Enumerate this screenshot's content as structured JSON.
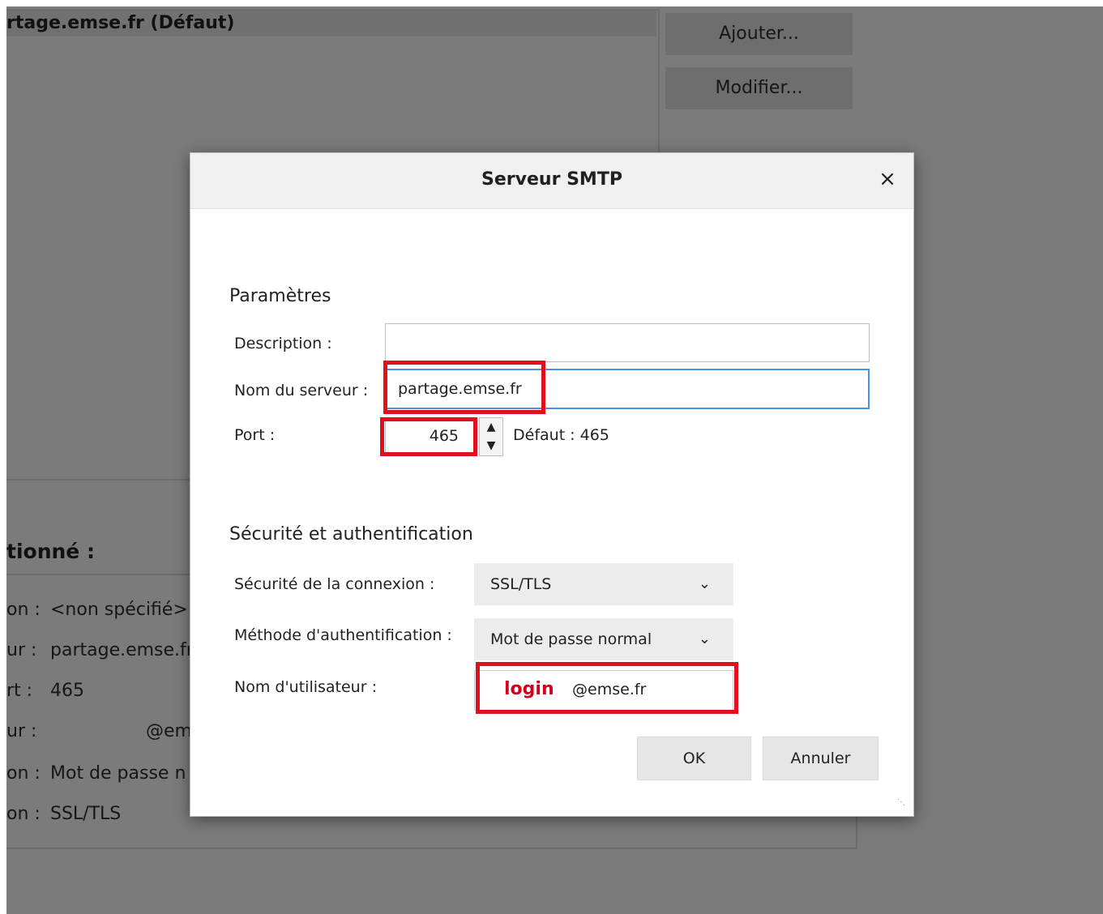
{
  "background": {
    "account_row": "rtage.emse.fr (Défaut)",
    "buttons": {
      "add": "Ajouter...",
      "edit": "Modifier..."
    },
    "details_title": "tionné :",
    "details": [
      {
        "label": "on :",
        "value": "<non spécifié>"
      },
      {
        "label": "ur :",
        "value": "partage.emse.fr"
      },
      {
        "label": "rt :",
        "value": "465"
      },
      {
        "label": "ur :",
        "value": "@em"
      },
      {
        "label": "on :",
        "value": "Mot de passe n"
      },
      {
        "label": "on :",
        "value": "SSL/TLS"
      }
    ]
  },
  "dialog": {
    "title": "Serveur SMTP",
    "close_glyph": "×",
    "settings_title": "Paramètres",
    "description_label": "Description :",
    "description_value": "",
    "server_label": "Nom du serveur :",
    "server_value": "partage.emse.fr",
    "port_label": "Port :",
    "port_value": "465",
    "default_label": "Défaut :  465",
    "security_title": "Sécurité et authentification",
    "connection_security_label": "Sécurité de la connexion :",
    "connection_security_value": "SSL/TLS",
    "auth_method_label": "Méthode d'authentification :",
    "auth_method_value": "Mot de passe normal",
    "username_label": "Nom d'utilisateur :",
    "username_login": "login",
    "username_domain": "@emse.fr",
    "ok_label": "OK",
    "cancel_label": "Annuler"
  },
  "colors": {
    "annotation": "#e0101c",
    "focus": "#4a90e2"
  }
}
